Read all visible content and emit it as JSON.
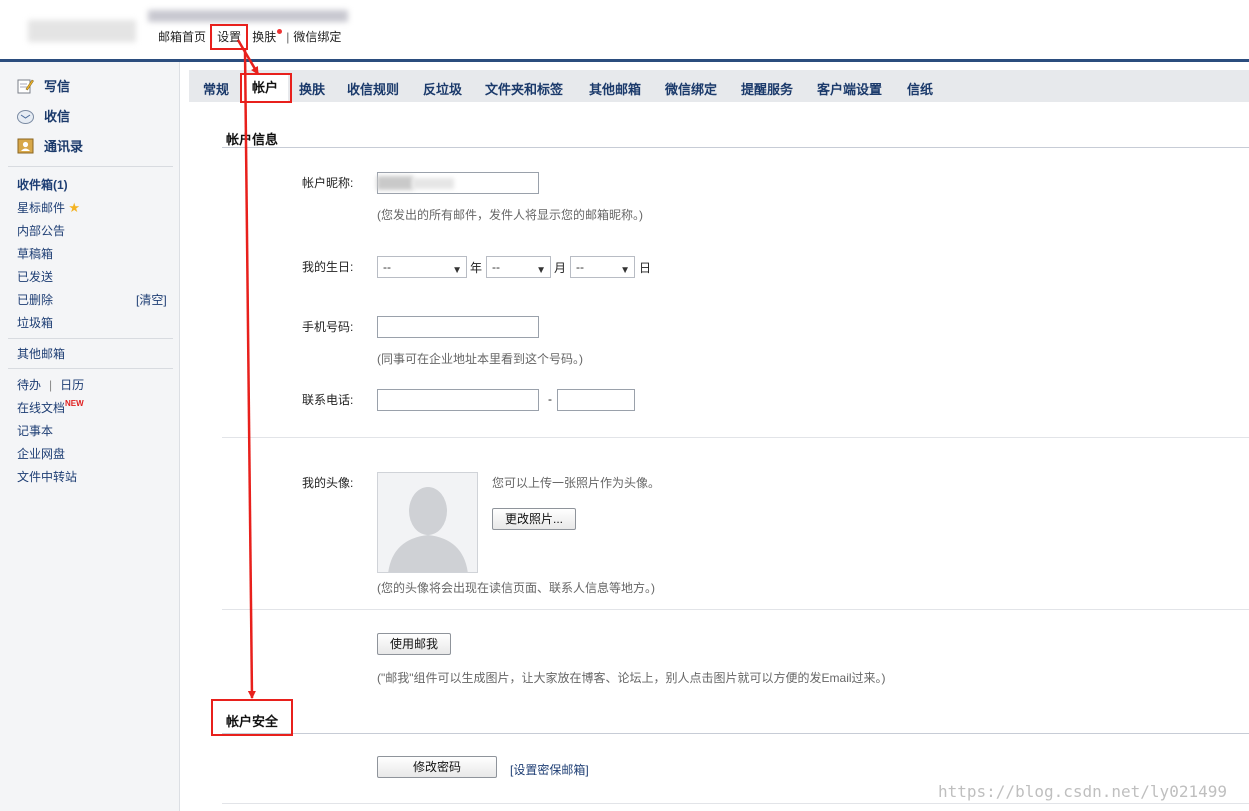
{
  "topnav": {
    "home": "邮箱首页",
    "settings": "设置",
    "skin": "换肤",
    "wechat": "微信绑定",
    "sep": "|"
  },
  "sidebar": {
    "compose": "写信",
    "receive": "收信",
    "contacts": "通讯录",
    "folders": [
      "收件箱(1)",
      "星标邮件",
      "内部公告",
      "草稿箱",
      "已发送",
      "已删除",
      "垃圾箱"
    ],
    "clear": "[清空]",
    "other_mailbox": "其他邮箱",
    "todo": "待办",
    "calendar": "日历",
    "tools": [
      "在线文档",
      "记事本",
      "企业网盘",
      "文件中转站"
    ],
    "new_badge": "NEW",
    "accent_color": "#1b3a6b"
  },
  "tabs": [
    "常规",
    "帐户",
    "换肤",
    "收信规则",
    "反垃圾",
    "文件夹和标签",
    "其他邮箱",
    "微信绑定",
    "提醒服务",
    "客户端设置",
    "信纸"
  ],
  "active_tab": "帐户",
  "account_info": {
    "title": "帐户信息",
    "nickname_label": "帐户昵称:",
    "nickname_hint": "(您发出的所有邮件，发件人将显示您的邮箱昵称。)",
    "birthday_label": "我的生日:",
    "birthday_year": "--",
    "birthday_month": "--",
    "birthday_day": "--",
    "year_unit": "年",
    "month_unit": "月",
    "day_unit": "日",
    "mobile_label": "手机号码:",
    "mobile_hint": "(同事可在企业地址本里看到这个号码。)",
    "phone_label": "联系电话:",
    "phone_dash": "-",
    "avatar_label": "我的头像:",
    "avatar_upload_hint": "您可以上传一张照片作为头像。",
    "change_photo_button": "更改照片...",
    "avatar_hint": "(您的头像将会出现在读信页面、联系人信息等地方。)",
    "use_youwo_button": "使用邮我",
    "youwo_hint": "(\"邮我\"组件可以生成图片，让大家放在博客、论坛上，别人点击图片就可以方便的发Email过来。)"
  },
  "account_security": {
    "title": "帐户安全",
    "change_password_button": "修改密码",
    "security_mailbox_link": "[设置密保邮箱]"
  },
  "watermark": "https://blog.csdn.net/ly021499",
  "colors": {
    "top_line": "#2b4d7e",
    "annotation_red": "#e8201c",
    "link": "#1e3e74"
  }
}
